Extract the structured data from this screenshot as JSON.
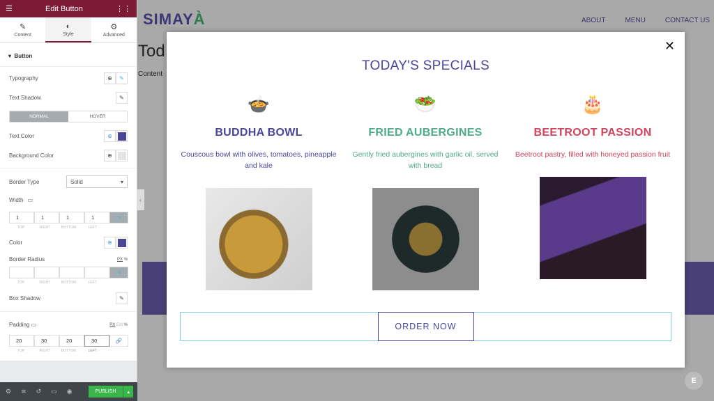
{
  "panel": {
    "title": "Edit Button",
    "tabs": [
      {
        "label": "Content",
        "icon": "✎"
      },
      {
        "label": "Style",
        "icon": "◐"
      },
      {
        "label": "Advanced",
        "icon": "⚙"
      }
    ],
    "section": "Button",
    "typography": "Typography",
    "text_shadow": "Text Shadow",
    "normal": "NORMAL",
    "hover": "HOVER",
    "text_color": "Text Color",
    "bg_color": "Background Color",
    "border_type": "Border Type",
    "border_type_value": "Solid",
    "width": "Width",
    "width_values": [
      "1",
      "1",
      "1",
      "1"
    ],
    "labels": [
      "TOP",
      "RIGHT",
      "BOTTOM",
      "LEFT"
    ],
    "color": "Color",
    "border_radius": "Border Radius",
    "units_px": "PX",
    "units_em": "EM",
    "units_pct": "%",
    "box_shadow": "Box Shadow",
    "padding": "Padding",
    "padding_values": [
      "20",
      "30",
      "20",
      "30"
    ],
    "publish": "PUBLISH",
    "swatch_color": "#4b449a"
  },
  "site": {
    "logo": "SIMAY",
    "logo_accent": "À",
    "nav": [
      "ABOUT",
      "MENU",
      "CONTACT US"
    ],
    "bg_heading": "Tod",
    "bg_text": "Content"
  },
  "modal": {
    "close": "✕",
    "title": "TODAY'S SPECIALS",
    "items": [
      {
        "name": "BUDDHA BOWL",
        "desc": "Couscous bowl with olives, tomatoes, pineapple and kale",
        "color": "#4b449a",
        "icon": "🍲"
      },
      {
        "name": "FRIED AUBERGINES",
        "desc": "Gently fried aubergines with garlic oil, served with bread",
        "color": "#4faa8a",
        "icon": "🥗"
      },
      {
        "name": "BEETROOT PASSION",
        "desc": "Beetroot pastry, filled with honeyed passion fruit",
        "color": "#d2435c",
        "icon": "🎂"
      }
    ],
    "order": "ORDER NOW"
  }
}
